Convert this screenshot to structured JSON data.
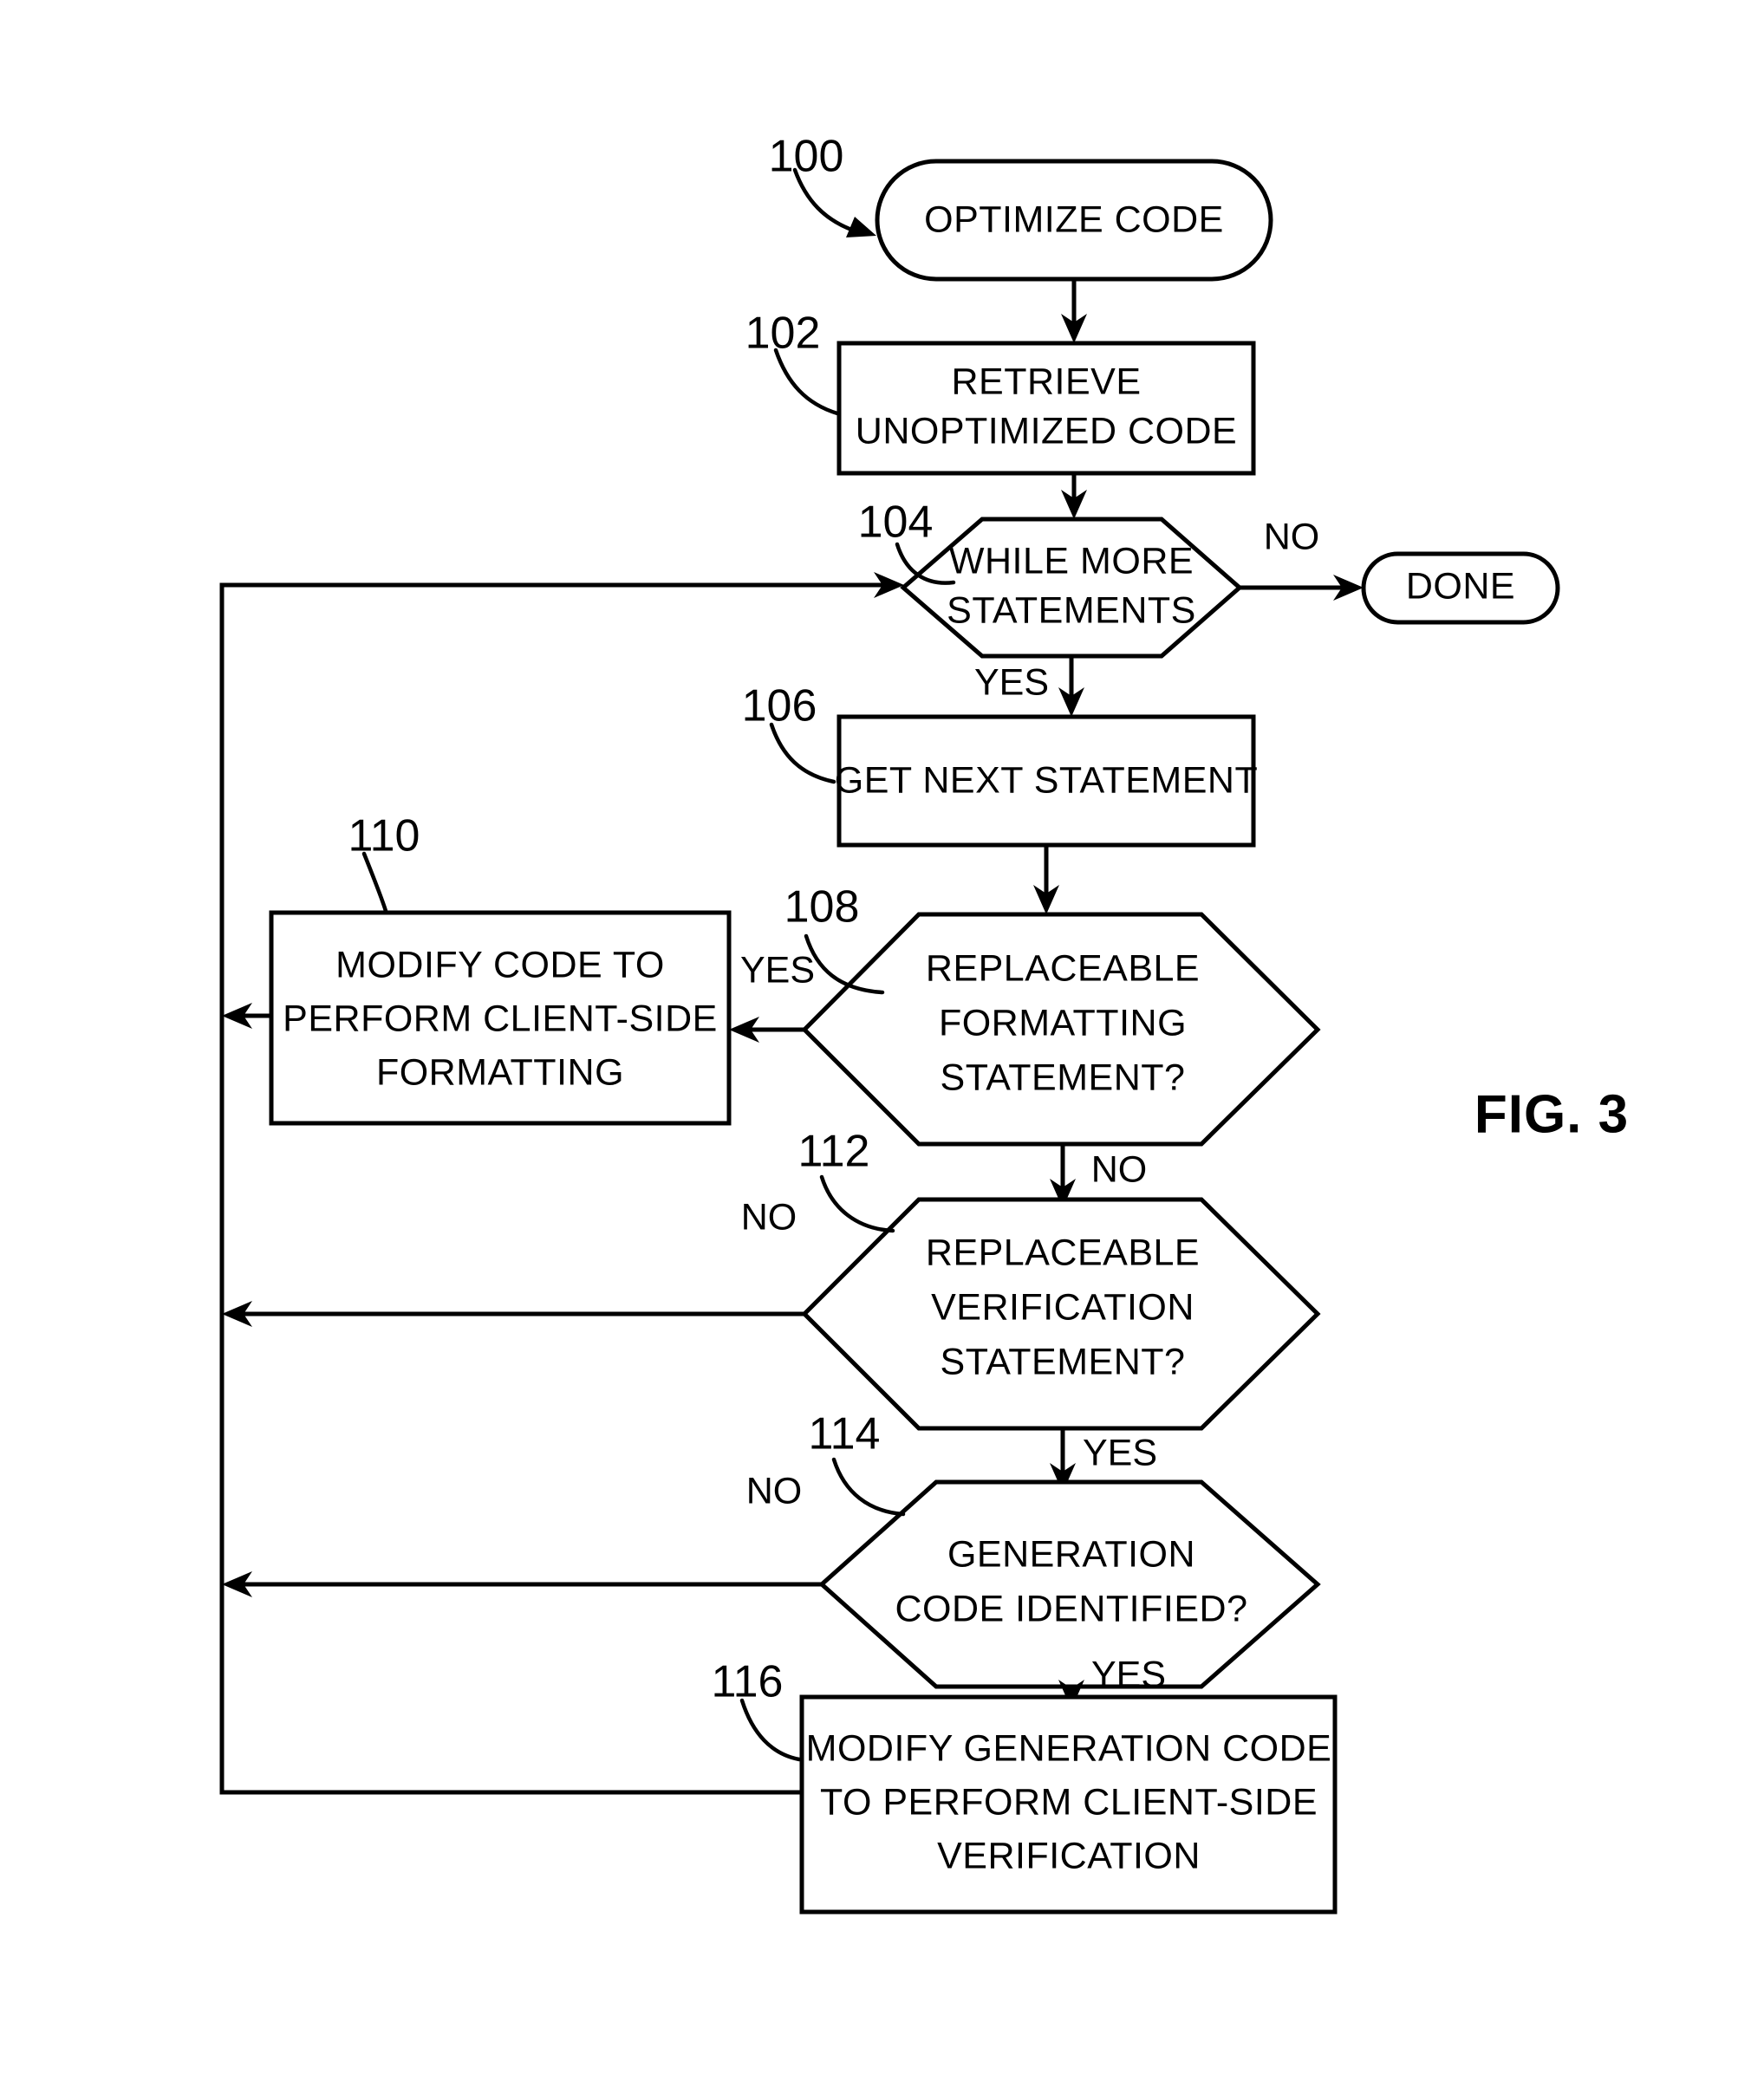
{
  "figure": {
    "label": "FIG. 3",
    "title": "OPTIMIZE CODE"
  },
  "nodes": {
    "n100": {
      "ref": "100",
      "shape": "terminator",
      "text": "OPTIMIZE CODE"
    },
    "n102": {
      "ref": "102",
      "shape": "process",
      "line1": "RETRIEVE",
      "line2": "UNOPTIMIZED CODE"
    },
    "n104": {
      "ref": "104",
      "shape": "decision",
      "line1": "WHILE MORE",
      "line2": "STATEMENTS"
    },
    "done": {
      "shape": "terminator",
      "text": "DONE"
    },
    "n106": {
      "ref": "106",
      "shape": "process",
      "text": "GET NEXT STATEMENT"
    },
    "n108": {
      "ref": "108",
      "shape": "decision",
      "line1": "REPLACEABLE",
      "line2": "FORMATTING",
      "line3": "STATEMENT?"
    },
    "n110": {
      "ref": "110",
      "shape": "process",
      "line1": "MODIFY CODE TO",
      "line2": "PERFORM CLIENT-SIDE",
      "line3": "FORMATTING"
    },
    "n112": {
      "ref": "112",
      "shape": "decision",
      "line1": "REPLACEABLE",
      "line2": "VERIFICATION",
      "line3": "STATEMENT?"
    },
    "n114": {
      "ref": "114",
      "shape": "decision",
      "line1": "GENERATION",
      "line2": "CODE IDENTIFIED?"
    },
    "n116": {
      "ref": "116",
      "shape": "process",
      "line1": "MODIFY GENERATION CODE",
      "line2": "TO PERFORM CLIENT-SIDE",
      "line3": "VERIFICATION"
    }
  },
  "edge_labels": {
    "e104_no": "NO",
    "e104_yes": "YES",
    "e108_yes": "YES",
    "e108_no": "NO",
    "e112_no": "NO",
    "e112_yes": "YES",
    "e114_no": "NO",
    "e114_yes": "YES"
  },
  "colors": {
    "line": "#000000",
    "fill": "#ffffff",
    "background": "#ffffff"
  }
}
